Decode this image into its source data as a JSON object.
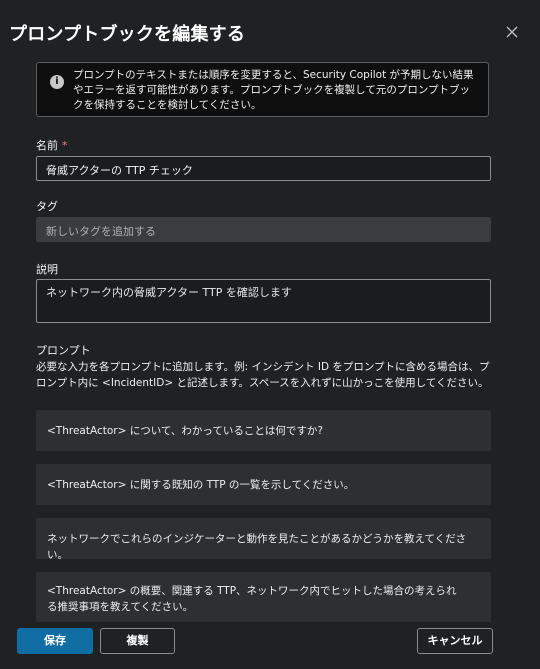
{
  "dialog": {
    "title": "プロンプトブックを編集する"
  },
  "notice": {
    "text": "プロンプトのテキストまたは順序を変更すると、Security Copilot が予期しない結果やエラーを返す可能性があります。プロンプトブックを複製して元のプロンプトブックを保持することを検討してください。"
  },
  "fields": {
    "name_label": "名前",
    "required_mark": "*",
    "name_value": "脅威アクターの TTP チェック",
    "tag_label": "タグ",
    "tag_placeholder": "新しいタグを追加する",
    "description_label": "説明",
    "description_value": "ネットワーク内の脅威アクター TTP を確認します"
  },
  "prompts": {
    "label": "プロンプト",
    "help": "必要な入力を各プロンプトに追加します。例: インシデント ID をプロンプトに含める場合は、プロンプト内に <IncidentID> と記述します。スペースを入れずに山かっこを使用してください。",
    "items": [
      "<ThreatActor> について、わかっていることは何ですか?",
      "<ThreatActor> に関する既知の TTP の一覧を示してください。",
      "ネットワークでこれらのインジケーターと動作を見たことがあるかどうかを教えてください。",
      "<ThreatActor> の概要、関連する TTP、ネットワーク内でヒットした場合の考えられる推奨事項を教えてください。"
    ]
  },
  "footer": {
    "save": "保存",
    "duplicate": "複製",
    "cancel": "キャンセル"
  },
  "colors": {
    "background": "#1f2123",
    "primary_button": "#106ea4",
    "required_mark": "#f08080"
  }
}
